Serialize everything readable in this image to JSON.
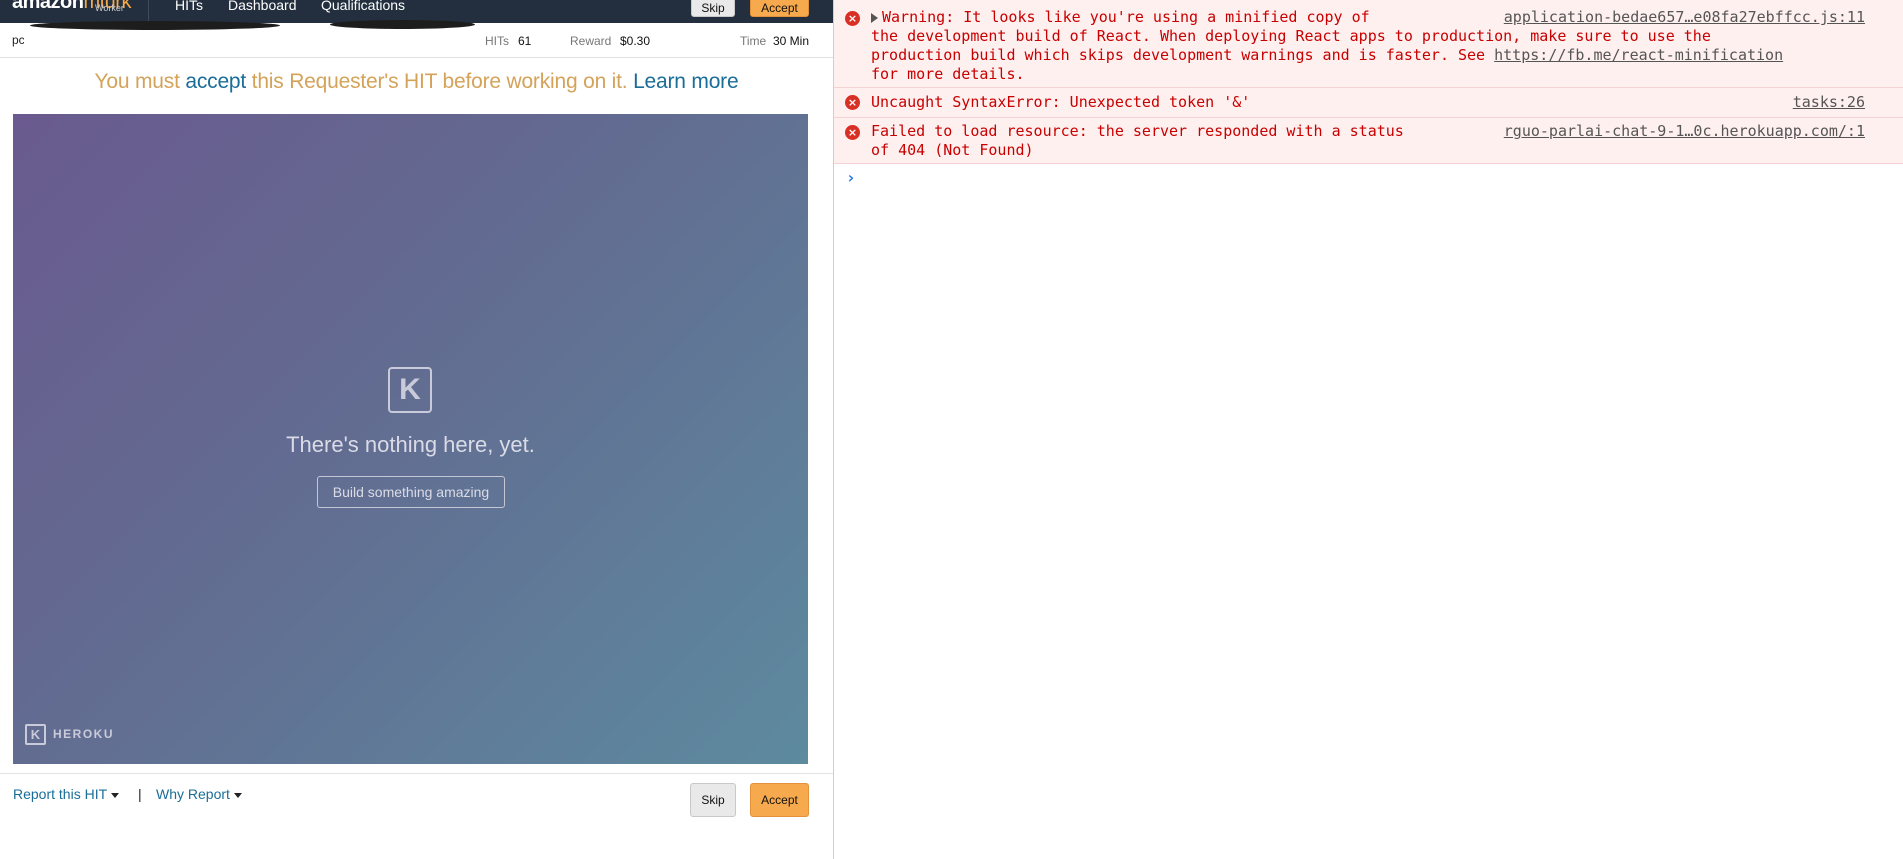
{
  "mturk": {
    "logo_word": "amazon",
    "logo_mt": "mturk",
    "logo_sub": "Worker",
    "nav": [
      "HITs",
      "Dashboard",
      "Qualifications"
    ],
    "skip_label": "Skip",
    "accept_label": "Accept",
    "requester_partial": "pc",
    "info": {
      "hits_label": "HITs",
      "hits_value": "61",
      "reward_label": "Reward",
      "reward_value": "$0.30",
      "time_label": "Time",
      "time_value": "30 Min"
    },
    "notice": {
      "prefix": "You must ",
      "accept_word": "accept",
      "middle": " this Requester's HIT before working on it. ",
      "learn_more": "Learn more"
    },
    "heroku": {
      "heading": "There's nothing here, yet.",
      "button": "Build something amazing",
      "footer": "HEROKU",
      "logo_glyph": "K"
    },
    "footer": {
      "report_hit": "Report this HIT",
      "separator": "|",
      "why_report": "Why Report"
    }
  },
  "console": {
    "messages": [
      {
        "lines": [
          "Warning: It looks like you're using a minified copy of",
          "the development build of React. When deploying React apps to production, make sure to use the",
          "production build which skips development warnings and is faster. See ",
          "for more details."
        ],
        "link": "https://fb.me/react-minification",
        "source": "application-bedae657…e08fa27ebffcc.js:11"
      },
      {
        "lines": [
          "Uncaught SyntaxError: Unexpected token '&'"
        ],
        "source": "tasks:26"
      },
      {
        "lines": [
          "Failed to load resource: the server responded with a status",
          "of 404 (Not Found)"
        ],
        "source": "rguo-parlai-chat-9-1…0c.herokuapp.com/:1"
      }
    ],
    "error_icon": "x-circle-icon",
    "prompt_icon": "chevron-right-icon"
  }
}
